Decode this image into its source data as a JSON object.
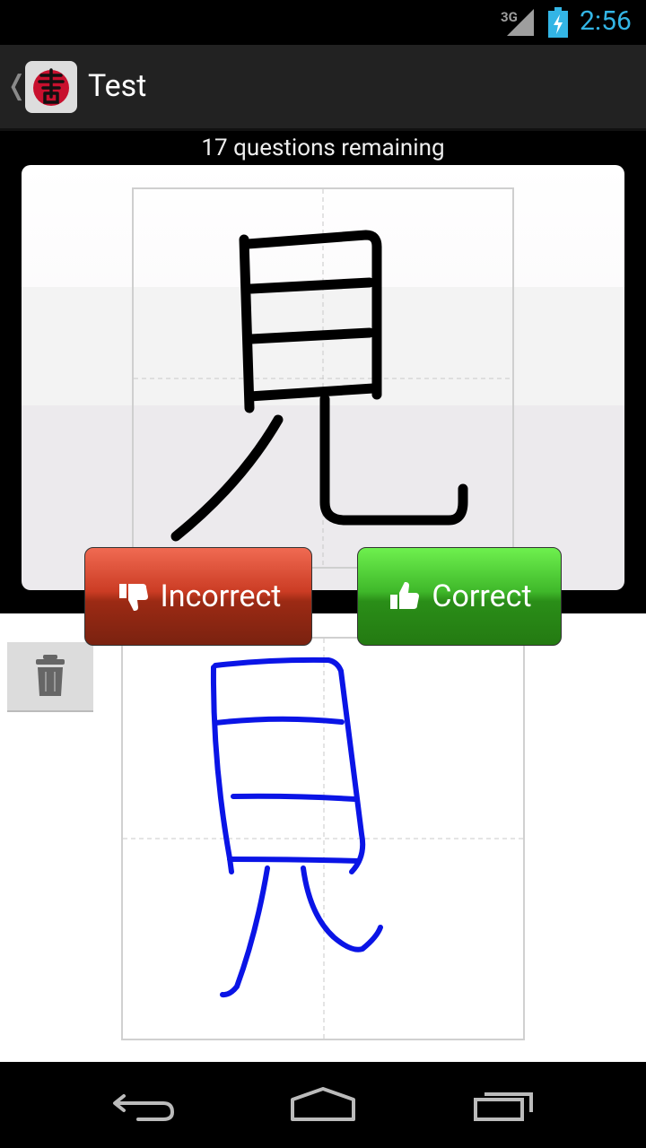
{
  "status_bar": {
    "network": "3G",
    "time": "2:56"
  },
  "action_bar": {
    "title": "Test"
  },
  "quiz": {
    "remaining_text": "17 questions remaining"
  },
  "buttons": {
    "incorrect_label": "Incorrect",
    "correct_label": "Correct"
  },
  "colors": {
    "clock": "#33b5e5",
    "stroke_reference": "#000000",
    "stroke_user": "#0000ee",
    "incorrect": "#cb3c24",
    "correct": "#3fb82a"
  }
}
